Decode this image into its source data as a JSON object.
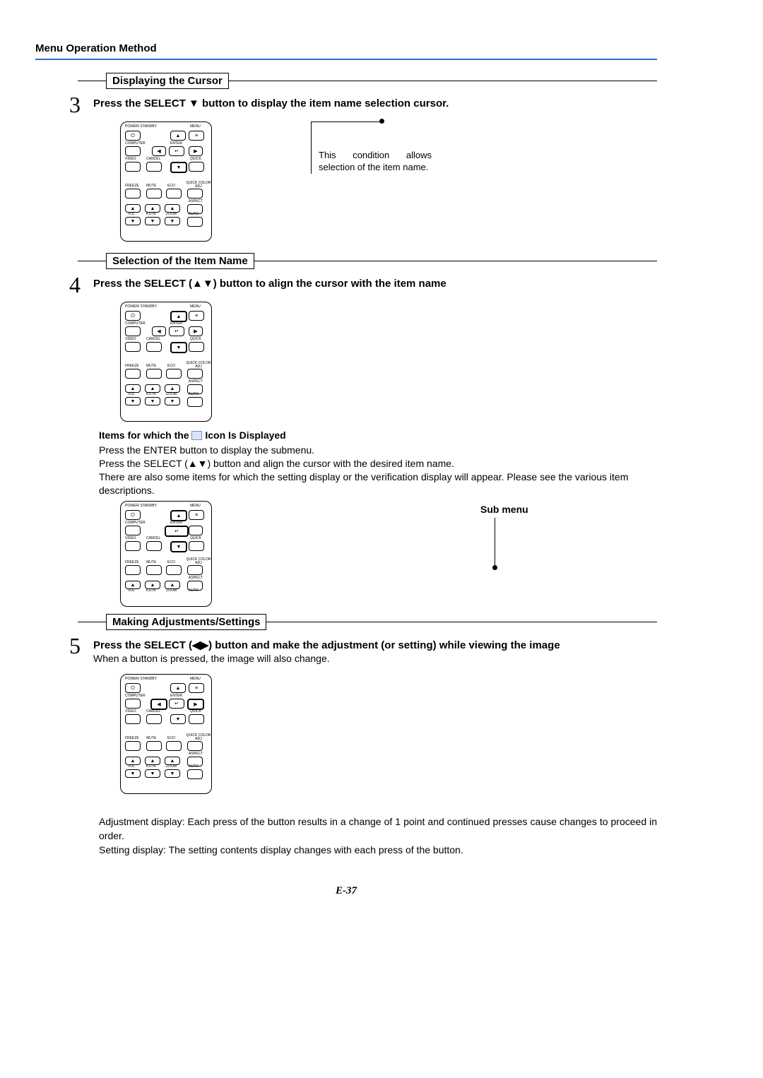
{
  "header": "Menu Operation Method",
  "sections": {
    "s3": {
      "title": "Displaying the Cursor",
      "num": "3",
      "instruction": "Press the SELECT ▼ button to display the item name selection cursor.",
      "callout": "This condition allows selection of the item name."
    },
    "s4": {
      "title": "Selection of the Item Name",
      "num": "4",
      "instruction": "Press the SELECT (▲▼) button to align the cursor with the item name",
      "items_heading_pre": "Items for which the ",
      "items_heading_post": " Icon Is Displayed",
      "items_line1": "Press the ENTER button to display the submenu.",
      "items_line2": "Press the SELECT (▲▼) button and align the cursor with the desired item name.",
      "items_line3": "There are also some items for which the setting display or the verification display will appear. Please see the various item descriptions.",
      "submenu_label": "Sub menu"
    },
    "s5": {
      "title": "Making Adjustments/Settings",
      "num": "5",
      "instruction": "Press the SELECT (◀▶) button and make the adjustment (or setting) while viewing the image",
      "sub": "When a button is pressed, the image will also change.",
      "bottom1": "Adjustment display: Each press of the button results in a change of 1 point and continued presses cause changes to proceed in order.",
      "bottom2": "Setting display: The setting contents display changes with each press of the button."
    }
  },
  "remote": {
    "power": "POWER/\nSTANDBY",
    "menu": "MENU",
    "computer": "COMPUTER",
    "enter": "ENTER",
    "video": "VIDEO",
    "cancel": "CANCEL",
    "quick": "QUICK",
    "freeze": "FREEZE",
    "mute": "MUTE",
    "eco": "ECO",
    "qcolor": "QUICK\nCOLOR ADJ",
    "aspect": "ASPECT",
    "vol": "VOL",
    "kstn": "KSTN",
    "zoom": "ZOOM",
    "auto": "AUTO"
  },
  "page": "E-37"
}
